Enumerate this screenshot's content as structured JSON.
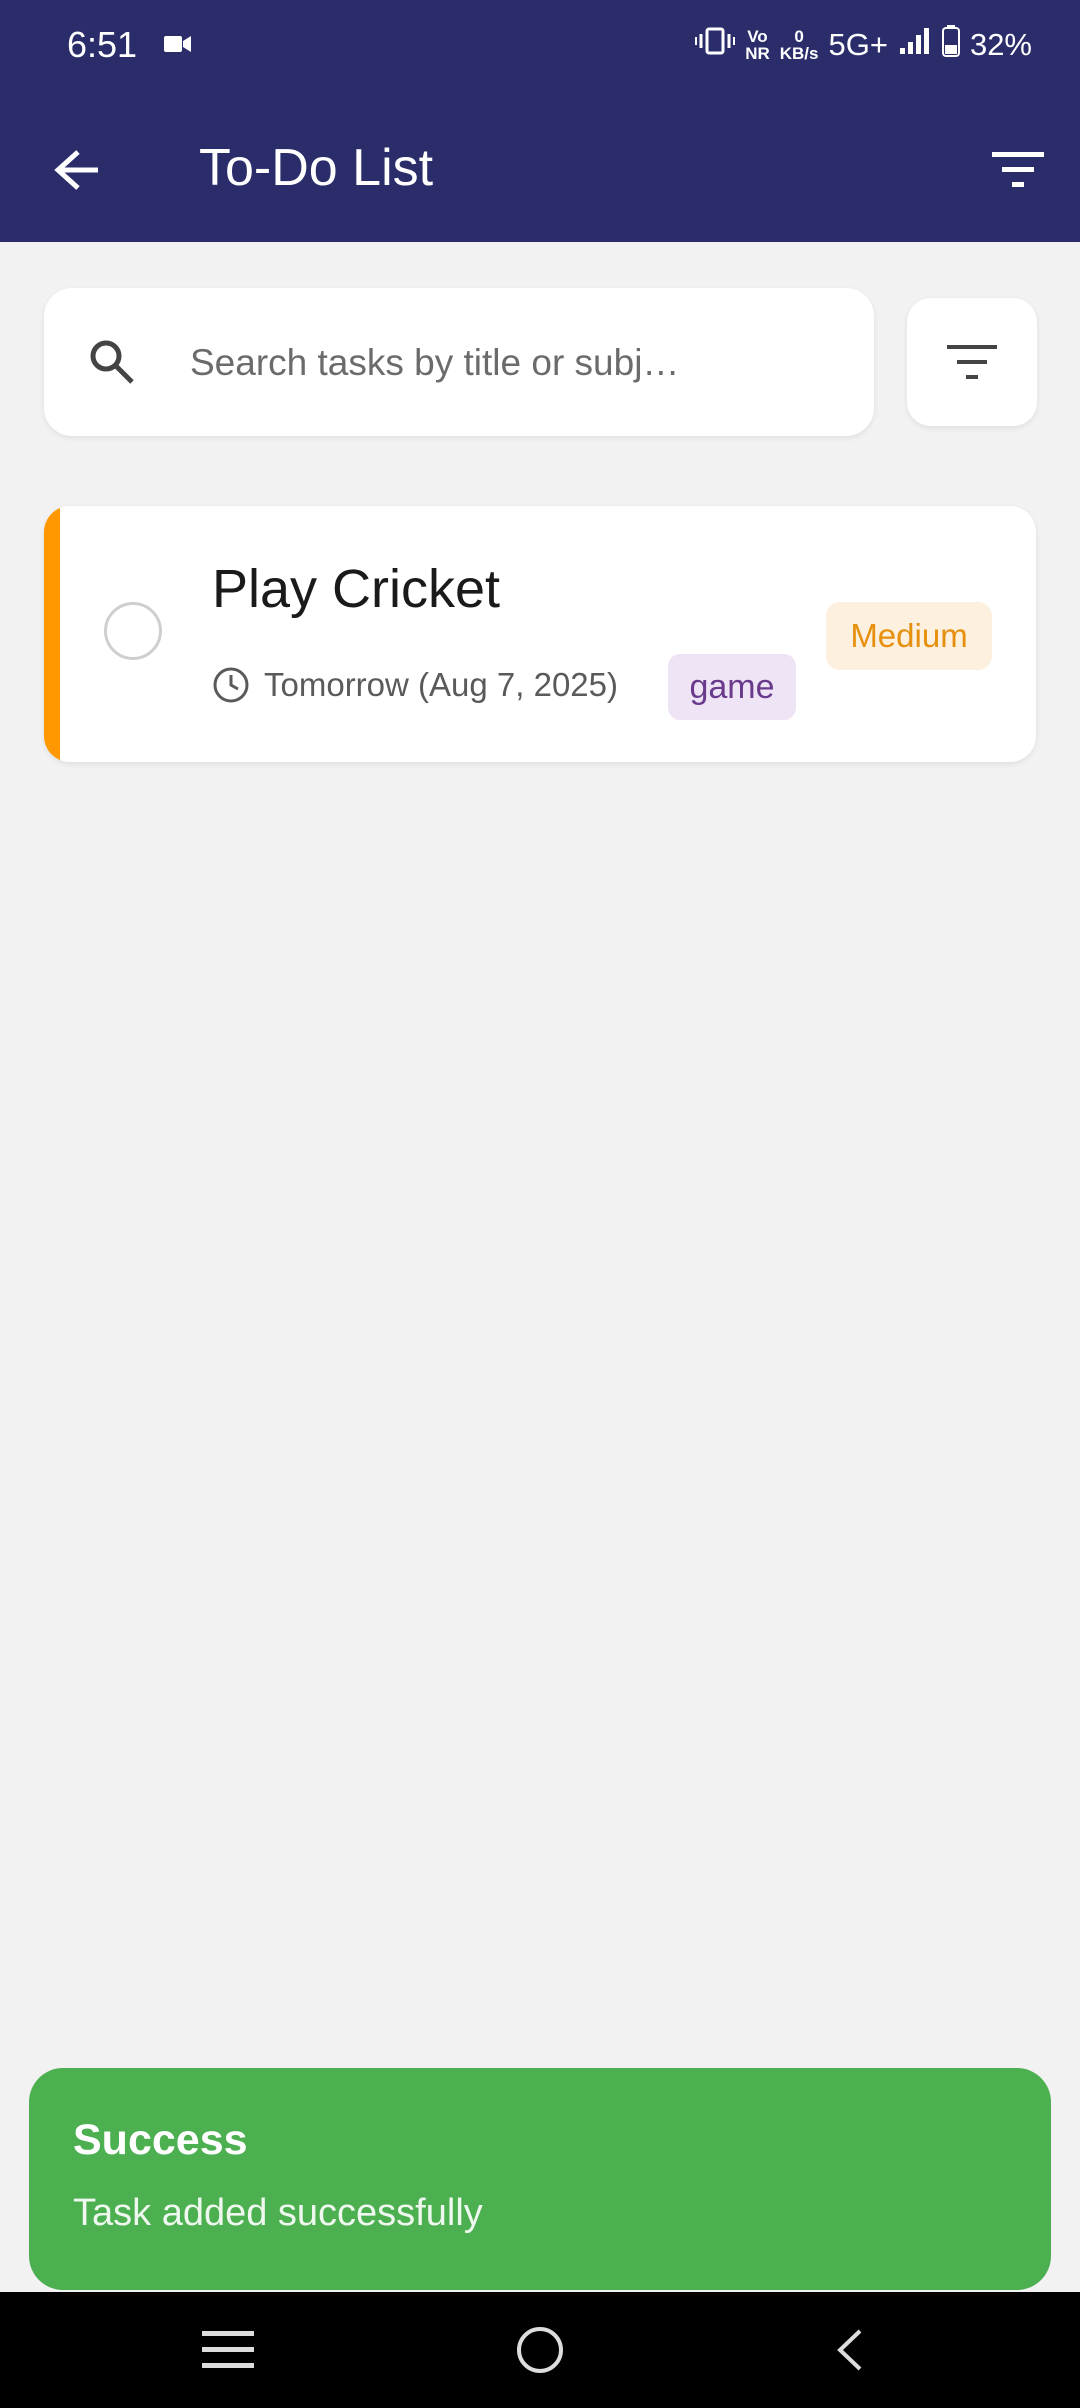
{
  "status_bar": {
    "time": "6:51",
    "network_top": "Vo",
    "network_bottom": "NR",
    "speed_top": "0",
    "speed_bottom": "KB/s",
    "network_type": "5G+",
    "battery": "32%"
  },
  "app_bar": {
    "title": "To-Do List",
    "back_icon": "arrow-left-icon",
    "menu_icon": "filter-list-icon"
  },
  "search": {
    "placeholder": "Search tasks by title or subj…",
    "icon": "search-icon",
    "filter_icon": "filter-list-icon"
  },
  "tasks": [
    {
      "title": "Play Cricket",
      "due": "Tomorrow (Aug 7, 2025)",
      "tag": "game",
      "priority": "Medium",
      "accent_color": "#ff9800",
      "completed": false
    }
  ],
  "toast": {
    "title": "Success",
    "message": "Task added successfully",
    "color": "#4caf50"
  },
  "nav_bar": {
    "icons": [
      "menu-icon",
      "home-icon",
      "back-icon"
    ]
  },
  "colors": {
    "primary": "#2b2d6b",
    "background": "#f2f2f2",
    "priority_medium": "#e6900d",
    "tag_text": "#6a3a8c"
  }
}
